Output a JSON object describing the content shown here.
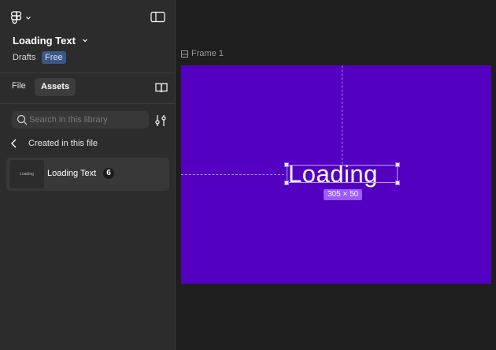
{
  "app": {
    "file_title": "Loading Text",
    "location": "Drafts",
    "plan_badge": "Free"
  },
  "tabs": {
    "file": "File",
    "assets": "Assets"
  },
  "search": {
    "placeholder": "Search in this library"
  },
  "library": {
    "back_label": "Created in this file",
    "components": [
      {
        "thumbnail_text": "Loading",
        "name": "Loading Text",
        "count": "6"
      }
    ]
  },
  "canvas": {
    "frame_label": "Frame 1",
    "frame_color": "#5300c0",
    "text_layer": "Loading",
    "selection_dimensions": "305 × 50"
  },
  "icons": [
    "figma-logo-icon",
    "chevron-down-icon",
    "sidebar-toggle-icon",
    "book-icon",
    "search-icon",
    "filter-icon",
    "chevron-left-icon",
    "frame-icon"
  ]
}
